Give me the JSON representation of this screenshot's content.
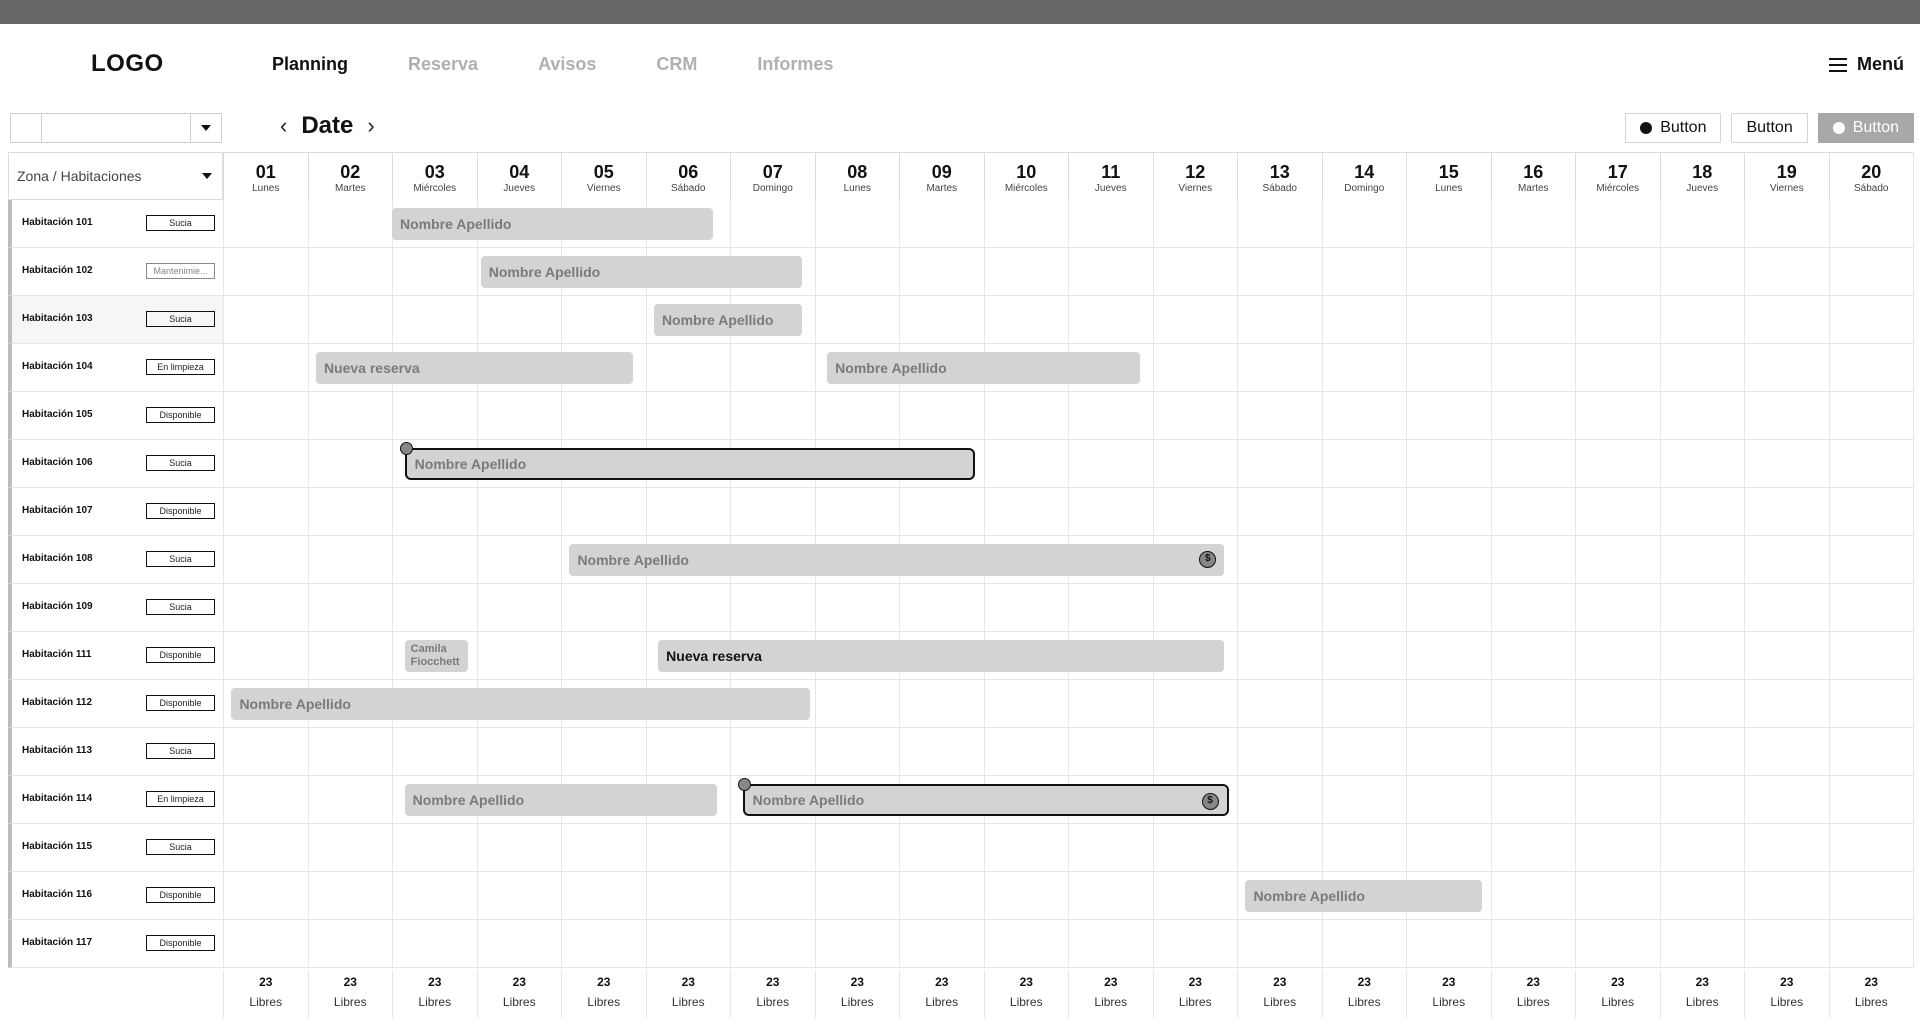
{
  "header": {
    "logo": "LOGO",
    "nav": [
      "Planning",
      "Reserva",
      "Avisos",
      "CRM",
      "Informes"
    ],
    "active_nav": "Planning",
    "menu_label": "Menú"
  },
  "toolbar": {
    "date_title": "Date",
    "buttons": [
      "Button",
      "Button",
      "Button"
    ]
  },
  "zone_selector": "Zona / Habitaciones",
  "days": [
    {
      "num": "01",
      "name": "Lunes"
    },
    {
      "num": "02",
      "name": "Martes"
    },
    {
      "num": "03",
      "name": "Miércoles"
    },
    {
      "num": "04",
      "name": "Jueves"
    },
    {
      "num": "05",
      "name": "Viernes"
    },
    {
      "num": "06",
      "name": "Sábado"
    },
    {
      "num": "07",
      "name": "Domingo"
    },
    {
      "num": "08",
      "name": "Lunes"
    },
    {
      "num": "09",
      "name": "Martes"
    },
    {
      "num": "10",
      "name": "Miércoles"
    },
    {
      "num": "11",
      "name": "Jueves"
    },
    {
      "num": "12",
      "name": "Viernes"
    },
    {
      "num": "13",
      "name": "Sábado"
    },
    {
      "num": "14",
      "name": "Domingo"
    },
    {
      "num": "15",
      "name": "Lunes"
    },
    {
      "num": "16",
      "name": "Martes"
    },
    {
      "num": "17",
      "name": "Miércoles"
    },
    {
      "num": "18",
      "name": "Jueves"
    },
    {
      "num": "19",
      "name": "Viernes"
    },
    {
      "num": "20",
      "name": "Sábado"
    }
  ],
  "rooms": [
    {
      "name": "Habitación 101",
      "status": "Sucia"
    },
    {
      "name": "Habitación 102",
      "status": "Mantenimie..."
    },
    {
      "name": "Habitación 103",
      "status": "Sucia"
    },
    {
      "name": "Habitación 104",
      "status": "En limpieza"
    },
    {
      "name": "Habitación 105",
      "status": "Disponible"
    },
    {
      "name": "Habitación 106",
      "status": "Sucia"
    },
    {
      "name": "Habitación 107",
      "status": "Disponible"
    },
    {
      "name": "Habitación 108",
      "status": "Sucia"
    },
    {
      "name": "Habitación 109",
      "status": "Sucia"
    },
    {
      "name": "Habitación 111",
      "status": "Disponible"
    },
    {
      "name": "Habitación 112",
      "status": "Disponible"
    },
    {
      "name": "Habitación 113",
      "status": "Sucia"
    },
    {
      "name": "Habitación 114",
      "status": "En limpieza"
    },
    {
      "name": "Habitación 115",
      "status": "Sucia"
    },
    {
      "name": "Habitación 116",
      "status": "Disponible"
    },
    {
      "name": "Habitación 117",
      "status": "Disponible"
    }
  ],
  "bookings": [
    {
      "room": 0,
      "start": 2,
      "end": 5.8,
      "label": "Nombre Apellido"
    },
    {
      "room": 1,
      "start": 3.05,
      "end": 6.85,
      "label": "Nombre Apellido"
    },
    {
      "room": 2,
      "start": 5.1,
      "end": 6.85,
      "label": "Nombre Apellido"
    },
    {
      "room": 3,
      "start": 1.1,
      "end": 4.85,
      "label": "Nueva reserva"
    },
    {
      "room": 3,
      "start": 7.15,
      "end": 10.85,
      "label": "Nombre Apellido"
    },
    {
      "room": 5,
      "start": 2.15,
      "end": 8.9,
      "label": "Nombre Apellido",
      "selected": true,
      "pin": true
    },
    {
      "room": 7,
      "start": 4.1,
      "end": 11.85,
      "label": "Nombre Apellido",
      "coin": true
    },
    {
      "room": 9,
      "start": 2.15,
      "end": 2.9,
      "label": "Camila Fiocchett",
      "small": true
    },
    {
      "room": 9,
      "start": 5.15,
      "end": 11.85,
      "label": "Nueva reserva",
      "dark": true
    },
    {
      "room": 10,
      "start": 0.1,
      "end": 6.95,
      "label": "Nombre Apellido"
    },
    {
      "room": 12,
      "start": 2.15,
      "end": 5.85,
      "label": "Nombre Apellido"
    },
    {
      "room": 12,
      "start": 6.15,
      "end": 11.9,
      "label": "Nombre Apellido",
      "selected": true,
      "pin": true,
      "coin": true
    },
    {
      "room": 14,
      "start": 12.1,
      "end": 14.9,
      "label": "Nombre Apellido"
    }
  ],
  "footer": {
    "count": "23",
    "label": "Libres"
  },
  "icons": {
    "prev": "chevron-left-icon",
    "next": "chevron-right-icon",
    "menu": "hamburger-icon",
    "pin": "pin-icon",
    "coin": "dollar-coin-icon"
  }
}
